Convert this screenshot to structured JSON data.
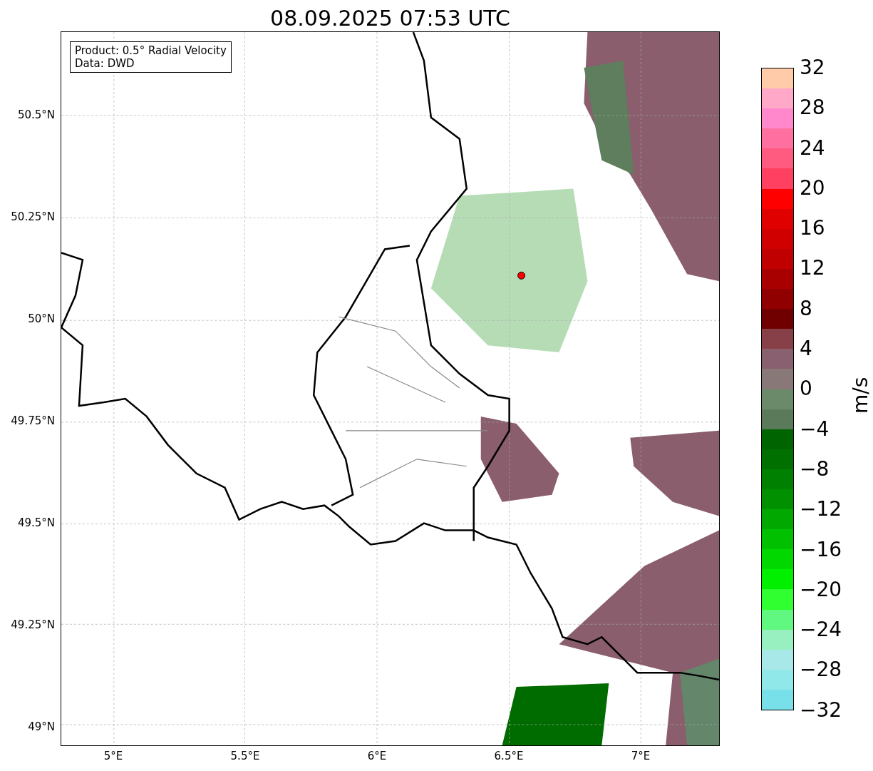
{
  "title": "08.09.2025 07:53 UTC",
  "info_box": [
    "Product: 0.5° Radial Velocity",
    "Data: DWD"
  ],
  "map": {
    "y_ticks": [
      "50.5°N",
      "50.25°N",
      "50°N",
      "49.75°N",
      "49.5°N",
      "49.25°N",
      "49°N"
    ],
    "x_ticks": [
      "5°E",
      "5.5°E",
      "6°E",
      "6.5°E",
      "7°E"
    ]
  },
  "colorbar": {
    "label": "m/s",
    "ticks": [
      "32",
      "28",
      "24",
      "20",
      "16",
      "12",
      "8",
      "4",
      "0",
      "−4",
      "−8",
      "−12",
      "−16",
      "−20",
      "−24",
      "−28",
      "−32"
    ],
    "segments": [
      {
        "color": "#ffcba8"
      },
      {
        "color": "#ffa8c8"
      },
      {
        "color": "#ff88cc"
      },
      {
        "color": "#ff70a0"
      },
      {
        "color": "#ff5a80"
      },
      {
        "color": "#ff4060"
      },
      {
        "color": "#ff0000"
      },
      {
        "color": "#e00000"
      },
      {
        "color": "#d00000"
      },
      {
        "color": "#c00000"
      },
      {
        "color": "#a80000"
      },
      {
        "color": "#900000"
      },
      {
        "color": "#700000"
      },
      {
        "color": "#884048"
      },
      {
        "color": "#886070"
      },
      {
        "color": "#887878"
      },
      {
        "color": "#6a8a6a"
      },
      {
        "color": "#5a7a5a"
      },
      {
        "color": "#006400"
      },
      {
        "color": "#007000"
      },
      {
        "color": "#008000"
      },
      {
        "color": "#009000"
      },
      {
        "color": "#00a800"
      },
      {
        "color": "#00c000"
      },
      {
        "color": "#00d800"
      },
      {
        "color": "#00f000"
      },
      {
        "color": "#30ff30"
      },
      {
        "color": "#60f880"
      },
      {
        "color": "#98f0c0"
      },
      {
        "color": "#a8e8e8"
      },
      {
        "color": "#90e8e8"
      },
      {
        "color": "#78e0e8"
      }
    ]
  }
}
